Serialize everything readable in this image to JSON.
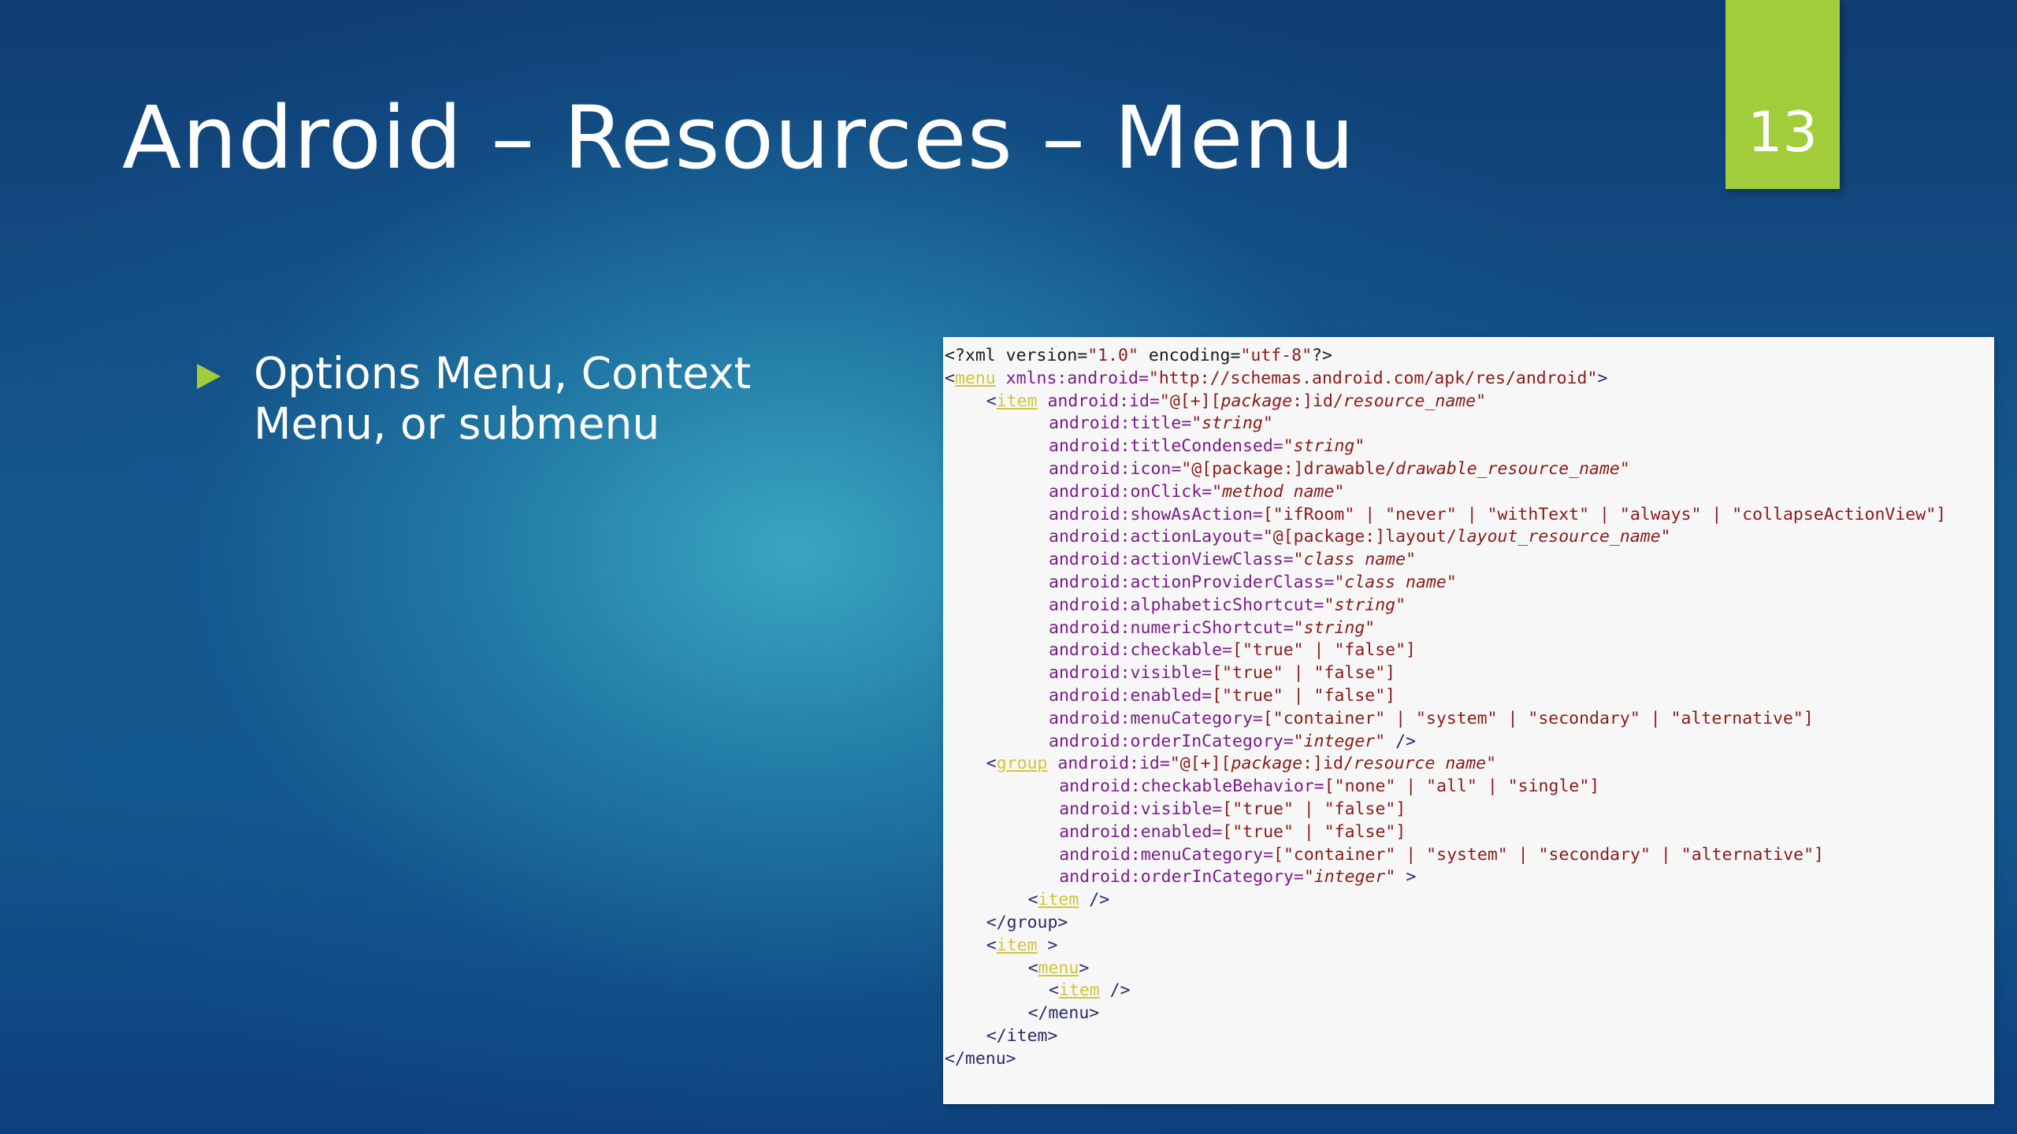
{
  "slide": {
    "title": "Android – Resources – Menu",
    "page_number": "13",
    "bullet": "Options Menu, Context Menu, or submenu"
  },
  "code": {
    "lines": [
      {
        "indent": 0,
        "tokens": [
          {
            "t": "<?xml version=",
            "c": "plain"
          },
          {
            "t": "\"1.0\"",
            "c": "str"
          },
          {
            "t": " encoding=",
            "c": "plain"
          },
          {
            "t": "\"utf-8\"",
            "c": "str"
          },
          {
            "t": "?>",
            "c": "plain"
          }
        ]
      },
      {
        "indent": 0,
        "tokens": [
          {
            "t": "<",
            "c": "punct"
          },
          {
            "t": "menu",
            "c": "tag"
          },
          {
            "t": " xmlns:android=",
            "c": "attr"
          },
          {
            "t": "\"http://schemas.android.com/apk/res/android\"",
            "c": "str"
          },
          {
            "t": ">",
            "c": "punct"
          }
        ]
      },
      {
        "indent": 4,
        "tokens": [
          {
            "t": "<",
            "c": "punct"
          },
          {
            "t": "item",
            "c": "tag"
          },
          {
            "t": " android:id=",
            "c": "attr"
          },
          {
            "t": "\"@[+][",
            "c": "str"
          },
          {
            "t": "package",
            "c": "str",
            "i": true
          },
          {
            "t": ":]id/",
            "c": "str"
          },
          {
            "t": "resource_name",
            "c": "str",
            "i": true
          },
          {
            "t": "\"",
            "c": "str"
          }
        ]
      },
      {
        "indent": 10,
        "tokens": [
          {
            "t": "android:title=",
            "c": "attr"
          },
          {
            "t": "\"",
            "c": "str"
          },
          {
            "t": "string",
            "c": "str",
            "i": true
          },
          {
            "t": "\"",
            "c": "str"
          }
        ]
      },
      {
        "indent": 10,
        "tokens": [
          {
            "t": "android:titleCondensed=",
            "c": "attr"
          },
          {
            "t": "\"",
            "c": "str"
          },
          {
            "t": "string",
            "c": "str",
            "i": true
          },
          {
            "t": "\"",
            "c": "str"
          }
        ]
      },
      {
        "indent": 10,
        "tokens": [
          {
            "t": "android:icon=",
            "c": "attr"
          },
          {
            "t": "\"@[package:]drawable/",
            "c": "str"
          },
          {
            "t": "drawable_resource_name",
            "c": "str",
            "i": true
          },
          {
            "t": "\"",
            "c": "str"
          }
        ]
      },
      {
        "indent": 10,
        "tokens": [
          {
            "t": "android:onClick=",
            "c": "attr"
          },
          {
            "t": "\"",
            "c": "str"
          },
          {
            "t": "method name",
            "c": "str",
            "i": true
          },
          {
            "t": "\"",
            "c": "str"
          }
        ]
      },
      {
        "indent": 10,
        "tokens": [
          {
            "t": "android:showAsAction=",
            "c": "attr"
          },
          {
            "t": "[\"ifRoom\" | \"never\" | \"withText\" | \"always\" | \"collapseActionView\"]",
            "c": "str"
          }
        ]
      },
      {
        "indent": 10,
        "tokens": [
          {
            "t": "android:actionLayout=",
            "c": "attr"
          },
          {
            "t": "\"@[package:]layout/",
            "c": "str"
          },
          {
            "t": "layout_resource_name",
            "c": "str",
            "i": true
          },
          {
            "t": "\"",
            "c": "str"
          }
        ]
      },
      {
        "indent": 10,
        "tokens": [
          {
            "t": "android:actionViewClass=",
            "c": "attr"
          },
          {
            "t": "\"",
            "c": "str"
          },
          {
            "t": "class name",
            "c": "str",
            "i": true
          },
          {
            "t": "\"",
            "c": "str"
          }
        ]
      },
      {
        "indent": 10,
        "tokens": [
          {
            "t": "android:actionProviderClass=",
            "c": "attr"
          },
          {
            "t": "\"",
            "c": "str"
          },
          {
            "t": "class name",
            "c": "str",
            "i": true
          },
          {
            "t": "\"",
            "c": "str"
          }
        ]
      },
      {
        "indent": 10,
        "tokens": [
          {
            "t": "android:alphabeticShortcut=",
            "c": "attr"
          },
          {
            "t": "\"",
            "c": "str"
          },
          {
            "t": "string",
            "c": "str",
            "i": true
          },
          {
            "t": "\"",
            "c": "str"
          }
        ]
      },
      {
        "indent": 10,
        "tokens": [
          {
            "t": "android:numericShortcut=",
            "c": "attr"
          },
          {
            "t": "\"",
            "c": "str"
          },
          {
            "t": "string",
            "c": "str",
            "i": true
          },
          {
            "t": "\"",
            "c": "str"
          }
        ]
      },
      {
        "indent": 10,
        "tokens": [
          {
            "t": "android:checkable=",
            "c": "attr"
          },
          {
            "t": "[\"true\" | \"false\"]",
            "c": "str"
          }
        ]
      },
      {
        "indent": 10,
        "tokens": [
          {
            "t": "android:visible=",
            "c": "attr"
          },
          {
            "t": "[\"true\" | \"false\"]",
            "c": "str"
          }
        ]
      },
      {
        "indent": 10,
        "tokens": [
          {
            "t": "android:enabled=",
            "c": "attr"
          },
          {
            "t": "[\"true\" | \"false\"]",
            "c": "str"
          }
        ]
      },
      {
        "indent": 10,
        "tokens": [
          {
            "t": "android:menuCategory=",
            "c": "attr"
          },
          {
            "t": "[\"container\" | \"system\" | \"secondary\" | \"alternative\"]",
            "c": "str"
          }
        ]
      },
      {
        "indent": 10,
        "tokens": [
          {
            "t": "android:orderInCategory=",
            "c": "attr"
          },
          {
            "t": "\"",
            "c": "str"
          },
          {
            "t": "integer",
            "c": "str",
            "i": true
          },
          {
            "t": "\"",
            "c": "str"
          },
          {
            "t": " />",
            "c": "punct"
          }
        ]
      },
      {
        "indent": 4,
        "tokens": [
          {
            "t": "<",
            "c": "punct"
          },
          {
            "t": "group",
            "c": "tag"
          },
          {
            "t": " android:id=",
            "c": "attr"
          },
          {
            "t": "\"@[+][",
            "c": "str"
          },
          {
            "t": "package",
            "c": "str",
            "i": true
          },
          {
            "t": ":]id/",
            "c": "str"
          },
          {
            "t": "resource name",
            "c": "str",
            "i": true
          },
          {
            "t": "\"",
            "c": "str"
          }
        ]
      },
      {
        "indent": 11,
        "tokens": [
          {
            "t": "android:checkableBehavior=",
            "c": "attr"
          },
          {
            "t": "[\"none\" | \"all\" | \"single\"]",
            "c": "str"
          }
        ]
      },
      {
        "indent": 11,
        "tokens": [
          {
            "t": "android:visible=",
            "c": "attr"
          },
          {
            "t": "[\"true\" | \"false\"]",
            "c": "str"
          }
        ]
      },
      {
        "indent": 11,
        "tokens": [
          {
            "t": "android:enabled=",
            "c": "attr"
          },
          {
            "t": "[\"true\" | \"false\"]",
            "c": "str"
          }
        ]
      },
      {
        "indent": 11,
        "tokens": [
          {
            "t": "android:menuCategory=",
            "c": "attr"
          },
          {
            "t": "[\"container\" | \"system\" | \"secondary\" | \"alternative\"]",
            "c": "str"
          }
        ]
      },
      {
        "indent": 11,
        "tokens": [
          {
            "t": "android:orderInCategory=",
            "c": "attr"
          },
          {
            "t": "\"",
            "c": "str"
          },
          {
            "t": "integer",
            "c": "str",
            "i": true
          },
          {
            "t": "\"",
            "c": "str"
          },
          {
            "t": " >",
            "c": "punct"
          }
        ]
      },
      {
        "indent": 8,
        "tokens": [
          {
            "t": "<",
            "c": "punct"
          },
          {
            "t": "item",
            "c": "tag"
          },
          {
            "t": " />",
            "c": "punct"
          }
        ]
      },
      {
        "indent": 4,
        "tokens": [
          {
            "t": "</group>",
            "c": "punct"
          }
        ]
      },
      {
        "indent": 4,
        "tokens": [
          {
            "t": "<",
            "c": "punct"
          },
          {
            "t": "item",
            "c": "tag"
          },
          {
            "t": " >",
            "c": "punct"
          }
        ]
      },
      {
        "indent": 8,
        "tokens": [
          {
            "t": "<",
            "c": "punct"
          },
          {
            "t": "menu",
            "c": "tag"
          },
          {
            "t": ">",
            "c": "punct"
          }
        ]
      },
      {
        "indent": 10,
        "tokens": [
          {
            "t": "<",
            "c": "punct"
          },
          {
            "t": "item",
            "c": "tag"
          },
          {
            "t": " />",
            "c": "punct"
          }
        ]
      },
      {
        "indent": 8,
        "tokens": [
          {
            "t": "</menu>",
            "c": "punct"
          }
        ]
      },
      {
        "indent": 4,
        "tokens": [
          {
            "t": "</item>",
            "c": "punct"
          }
        ]
      },
      {
        "indent": 0,
        "tokens": [
          {
            "t": "</menu>",
            "c": "punct"
          }
        ]
      }
    ]
  }
}
